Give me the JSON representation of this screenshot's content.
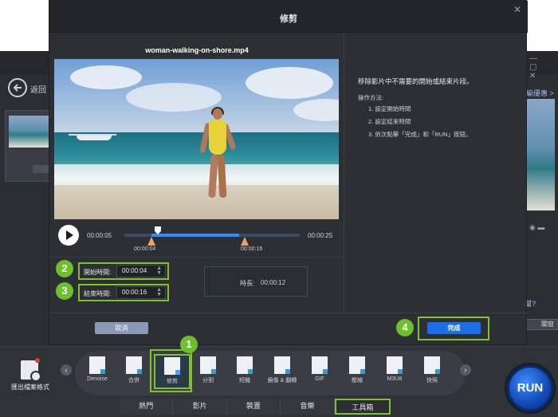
{
  "background": {
    "back_label": "返回",
    "right_link": "編優惠 >",
    "right_icons": "◉ ▬",
    "help_text": "幫",
    "help_q": "?",
    "side_close": "關窗"
  },
  "modal": {
    "title": "修剪",
    "close_icon": "✕",
    "file_name": "woman-walking-on-shore.mp4",
    "player": {
      "time_start": "00:00:05",
      "time_end": "00:00:25",
      "marker_start_time": "00:00:04",
      "marker_end_time": "00:00:16"
    },
    "start_field": {
      "label": "開始時間:",
      "value": "00:00:04"
    },
    "end_field": {
      "label": "結束時間:",
      "value": "00:00:16"
    },
    "duration": {
      "label": "時長:",
      "value": "00:00:12"
    },
    "description": {
      "main": "移除影片中不需要的開始或結束片段。",
      "sub": "操作方法:",
      "steps": [
        "1. 設定開始時間",
        "2. 設定結束時間",
        "3. 依次點擊「完成」和「RUN」按鈕。"
      ]
    },
    "cancel_label": "取消",
    "done_label": "完成"
  },
  "badges": [
    "1",
    "2",
    "3",
    "4"
  ],
  "toolbox": {
    "export_label": "匯出檔案格式",
    "tools": [
      {
        "label": "Denoise",
        "top": "Excellent"
      },
      {
        "label": "合併"
      },
      {
        "label": "修剪"
      },
      {
        "label": "分割"
      },
      {
        "label": "短機"
      },
      {
        "label": "鏡像 & 翻轉"
      },
      {
        "label": "GIF"
      },
      {
        "label": "壓縮"
      },
      {
        "label": "M3U8"
      },
      {
        "label": "快照"
      }
    ],
    "tabs": [
      "熱門",
      "影片",
      "裝置",
      "音樂",
      "工具箱"
    ],
    "run_label": "RUN"
  },
  "colors": {
    "accent_green": "#7ec234",
    "primary_blue": "#1a6fe8",
    "track_blue": "#2d8cff",
    "marker_orange": "#f0a062"
  }
}
